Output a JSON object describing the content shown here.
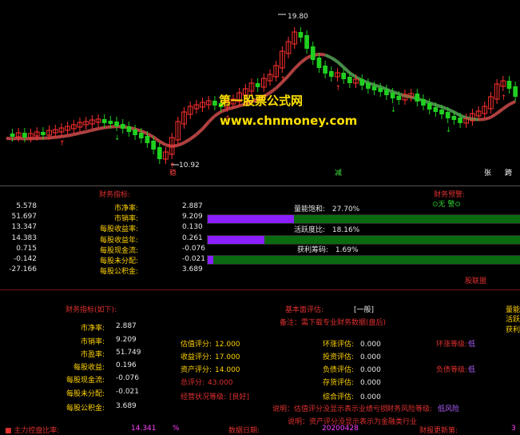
{
  "chart": {
    "high_label": "19.80",
    "low_label": "10.92",
    "watermark_title": "第一股票公式网",
    "watermark_url": "www.chnmoney.com",
    "markers": [
      {
        "text": "稳",
        "color": "#ff4040"
      },
      {
        "text": "减",
        "color": "#40e040"
      },
      {
        "text": "张",
        "color": "#ffffff"
      },
      {
        "text": "跨",
        "color": "#ffffff"
      }
    ]
  },
  "panel1": {
    "left_header": "财务指标:",
    "right_header": "财务预警:",
    "right_status": "⊙无 警⊙",
    "rows": [
      {
        "value": "5.578",
        "label": "市净率:",
        "value2": "2.887"
      },
      {
        "value": "51.697",
        "label": "市销率:",
        "value2": "9.209"
      },
      {
        "value": "13.347",
        "label": "每股收益率:",
        "value2": "0.130"
      },
      {
        "value": "14.383",
        "label": "每股收益年:",
        "value2": "0.261"
      },
      {
        "value": "0.715",
        "label": "每股现金流:",
        "value2": "-0.076"
      },
      {
        "value": "-0.142",
        "label": "每股未分配:",
        "value2": "-0.021"
      },
      {
        "value": "-27.166",
        "label": "每股公积金:",
        "value2": "3.689"
      }
    ],
    "bars": [
      {
        "label": "量能饱和:",
        "value": "27.70%",
        "fraction": 0.277
      },
      {
        "label": "活跃度比:",
        "value": "18.16%",
        "fraction": 0.1816
      },
      {
        "label": "获利筹码:",
        "value": "1.69%",
        "fraction": 0.0169
      }
    ],
    "footer": "股联盟"
  },
  "panel2": {
    "title": "财务指标(如下):",
    "rows": [
      {
        "label": "市净率:",
        "value": "2.887"
      },
      {
        "label": "市销率:",
        "value": "9.209"
      },
      {
        "label": "市盈率:",
        "value": "51.749"
      },
      {
        "label": "每股收益:",
        "value": "0.196"
      },
      {
        "label": "每股现金流:",
        "value": "-0.076"
      },
      {
        "label": "每股未分配:",
        "value": "-0.021"
      },
      {
        "label": "每股公积金:",
        "value": "3.689"
      }
    ],
    "basic_label": "基本面评估:",
    "basic_value": "[一般]",
    "note": "备注：需下载专业财务数据(盘后)",
    "scores": [
      {
        "label": "估值评分:",
        "value": "12.000"
      },
      {
        "label": "收益评分:",
        "value": "17.000"
      },
      {
        "label": "资产评分:",
        "value": "14.000"
      },
      {
        "label": "总评分:",
        "value": "43.000"
      },
      {
        "label": "经营状况等级:",
        "value": "[良好]"
      }
    ],
    "risks": [
      {
        "label": "环涨评估:",
        "value": "0.000"
      },
      {
        "label": "投资评估:",
        "value": "0.000"
      },
      {
        "label": "负债评估:",
        "value": "0.000"
      },
      {
        "label": "存货评估:",
        "value": "0.000"
      },
      {
        "label": "综合评估:",
        "value": "0.000"
      }
    ],
    "levels": [
      {
        "label": "环涨等级:",
        "value": "低"
      },
      {
        "label": "负债等级:",
        "value": "低"
      }
    ],
    "fin_risk_label": "财务风险等级:",
    "fin_risk_value": "低风险",
    "explain1": "说明：估值评分没显示表示业绩亏损",
    "explain2": "说明：资产评分没显示表示为金融类行业",
    "cut_right": [
      "量能",
      "活跃",
      "获利"
    ],
    "status": {
      "item1_label": "主力控盘比率:",
      "item1_value": "14.341",
      "item1_unit": "%",
      "date_label": "数据日期:",
      "date_value": "20200428",
      "update_label": "财报更新第:",
      "update_value": "3"
    }
  },
  "colors": {
    "up": "#ff3030",
    "down": "#20d020",
    "ma": "#b04040",
    "ma_green": "#4a8a4a",
    "bar_bg": "#0a6a10",
    "bar_fill": "#8b1fff"
  }
}
